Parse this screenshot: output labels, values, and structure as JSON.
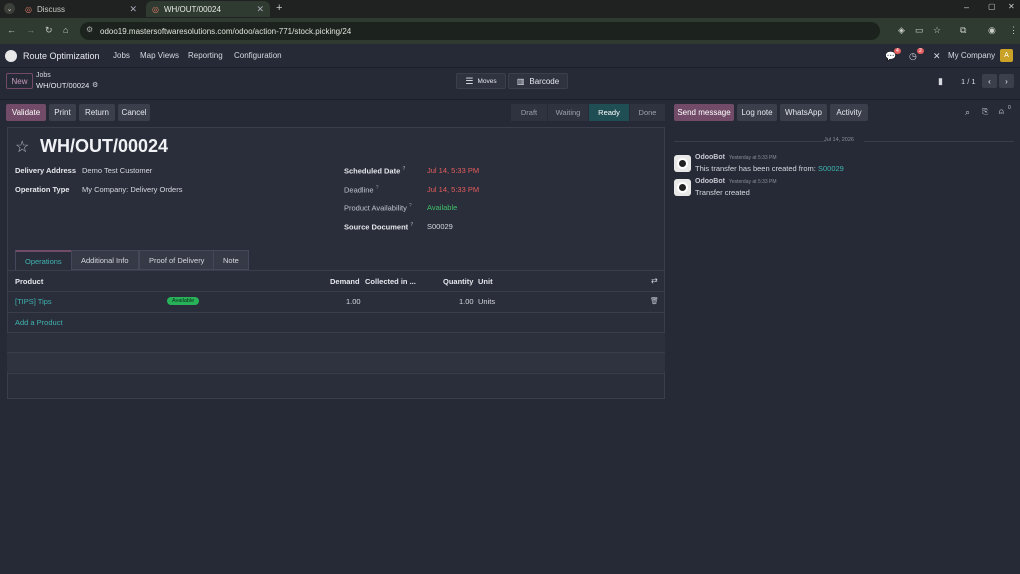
{
  "browser": {
    "tabs": [
      {
        "label": "Discuss"
      },
      {
        "label": "WH/OUT/00024"
      }
    ],
    "url": "odoo19.mastersoftwaresolutions.com/odoo/action-771/stock.picking/24"
  },
  "navbar": {
    "app_name": "Route Optimization",
    "menu": [
      "Jobs",
      "Map Views",
      "Reporting",
      "Configuration"
    ],
    "messages_count": "4",
    "activities_count": "2",
    "company": "My Company",
    "avatar_letter": "A"
  },
  "control_panel": {
    "new_label": "New",
    "breadcrumb_parent": "Jobs",
    "breadcrumb_current": "WH/OUT/00024",
    "moves_label": "Moves",
    "barcode_label": "Barcode",
    "pager": "1 / 1"
  },
  "actions": {
    "validate": "Validate",
    "print": "Print",
    "return": "Return",
    "cancel": "Cancel"
  },
  "statusbar": {
    "stages": [
      "Draft",
      "Waiting",
      "Ready",
      "Done"
    ],
    "active": "Ready"
  },
  "form": {
    "title": "WH/OUT/00024",
    "delivery_address_label": "Delivery Address",
    "delivery_address": "Demo Test Customer",
    "operation_type_label": "Operation Type",
    "operation_type": "My Company: Delivery Orders",
    "scheduled_date_label": "Scheduled Date",
    "scheduled_date": "Jul 14, 5:33 PM",
    "deadline_label": "Deadline",
    "deadline": "Jul 14, 5:33 PM",
    "availability_label": "Product Availability",
    "availability": "Available",
    "source_document_label": "Source Document",
    "source_document": "S00029",
    "help_mark": "?"
  },
  "notebook": {
    "tabs": [
      "Operations",
      "Additional Info",
      "Proof of Delivery",
      "Note"
    ]
  },
  "table": {
    "headers": [
      "Product",
      "Demand",
      "Collected in ...",
      "Quantity",
      "Unit"
    ],
    "rows": [
      {
        "product": "[TIPS] Tips",
        "badge": "Available",
        "demand": "1.00",
        "collected": "",
        "quantity": "1.00",
        "unit": "Units"
      }
    ],
    "add_line": "Add a Product"
  },
  "chatter": {
    "send_message": "Send message",
    "log_note": "Log note",
    "whatsapp": "WhatsApp",
    "activity": "Activity",
    "followers_count": "0",
    "date_separator": "Jul 14, 2026",
    "messages": [
      {
        "author": "OdooBot",
        "time": "Yesterday at 5:33 PM",
        "body": "This transfer has been created from:",
        "link": "S00029"
      },
      {
        "author": "OdooBot",
        "time": "Yesterday at 5:33 PM",
        "body": "Transfer created",
        "link": ""
      }
    ]
  },
  "colors": {
    "primary": "#714b67",
    "accent": "#3fb3b0",
    "danger": "#e55d5d",
    "success": "#3fbf6a"
  }
}
